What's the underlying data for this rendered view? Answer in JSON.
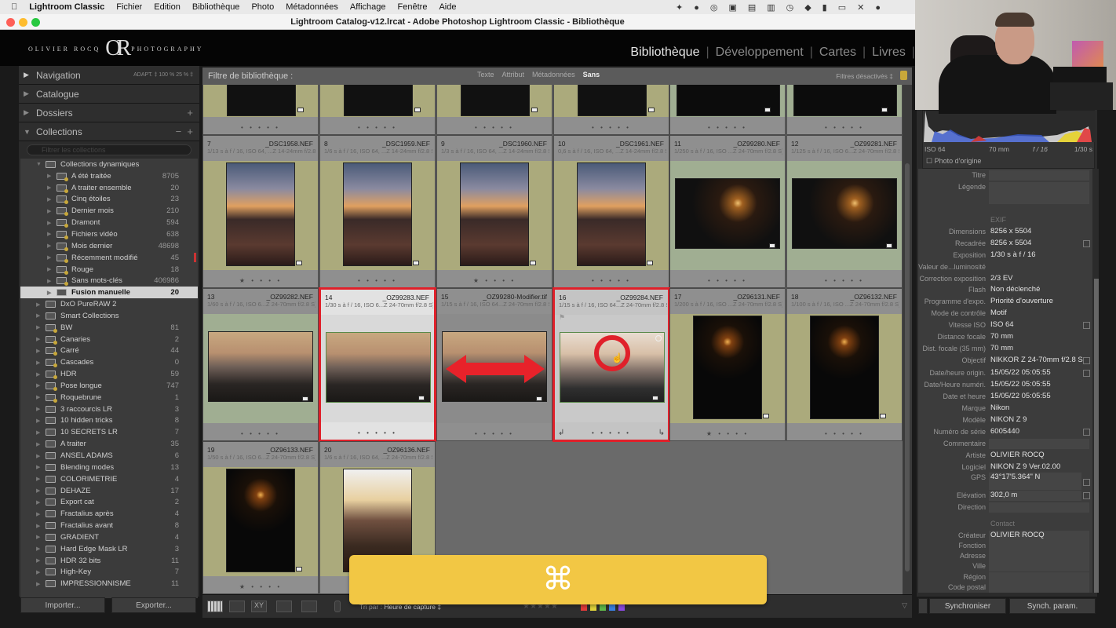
{
  "menubar": {
    "app": "Lightroom Classic",
    "items": [
      "Fichier",
      "Edition",
      "Bibliothèque",
      "Photo",
      "Métadonnées",
      "Affichage",
      "Fenêtre",
      "Aide"
    ]
  },
  "window": {
    "title": "Lightroom Catalog-v12.lrcat - Adobe Photoshop Lightroom Classic - Bibliothèque"
  },
  "identity_plate": {
    "left": "OLIVIER ROCQ",
    "mark": "OR",
    "right": "PHOTOGRAPHY"
  },
  "modules": [
    {
      "label": "Bibliothèque",
      "active": true
    },
    {
      "label": "Développement"
    },
    {
      "label": "Cartes"
    },
    {
      "label": "Livres"
    }
  ],
  "left_panel": {
    "navigation": {
      "label": "Navigation",
      "zoom_options": "ADAPT. ‡   100 %   25 % ‡"
    },
    "catalogue": "Catalogue",
    "dossiers": "Dossiers",
    "collections": "Collections",
    "collections_search_placeholder": "Filtrer les collections",
    "items": [
      {
        "name": "Collections dynamiques",
        "count": "",
        "type": "set",
        "level": 0,
        "expanded": true
      },
      {
        "name": "A été traitée",
        "count": "8705",
        "type": "smart",
        "level": 1
      },
      {
        "name": "A traiter ensemble",
        "count": "20",
        "type": "smart",
        "level": 1
      },
      {
        "name": "Cinq étoiles",
        "count": "23",
        "type": "smart",
        "level": 1
      },
      {
        "name": "Dernier mois",
        "count": "210",
        "type": "smart",
        "level": 1
      },
      {
        "name": "Dramont",
        "count": "594",
        "type": "smart",
        "level": 1
      },
      {
        "name": "Fichiers vidéo",
        "count": "638",
        "type": "smart",
        "level": 1
      },
      {
        "name": "Mois dernier",
        "count": "48698",
        "type": "smart",
        "level": 1
      },
      {
        "name": "Récemment modifié",
        "count": "45",
        "type": "smart",
        "level": 1
      },
      {
        "name": "Rouge",
        "count": "18",
        "type": "smart",
        "level": 1
      },
      {
        "name": "Sans mots-clés",
        "count": "406986",
        "type": "smart",
        "level": 1
      },
      {
        "name": "Fusion manuelle",
        "count": "20",
        "type": "normal",
        "level": 1,
        "selected": true
      },
      {
        "name": "DxO PureRAW 2",
        "count": "",
        "type": "set",
        "level": 0
      },
      {
        "name": "Smart Collections",
        "count": "",
        "type": "set",
        "level": 0
      },
      {
        "name": "BW",
        "count": "81",
        "type": "smart",
        "level": 0
      },
      {
        "name": "Canaries",
        "count": "2",
        "type": "smart",
        "level": 0
      },
      {
        "name": "Carré",
        "count": "44",
        "type": "smart",
        "level": 0
      },
      {
        "name": "Cascades",
        "count": "0",
        "type": "smart",
        "level": 0
      },
      {
        "name": "HDR",
        "count": "59",
        "type": "smart",
        "level": 0
      },
      {
        "name": "Pose longue",
        "count": "747",
        "type": "smart",
        "level": 0
      },
      {
        "name": "Roquebrune",
        "count": "1",
        "type": "smart",
        "level": 0
      },
      {
        "name": "3 raccourcis LR",
        "count": "3",
        "type": "normal",
        "level": 0
      },
      {
        "name": "10 hidden tricks",
        "count": "8",
        "type": "normal",
        "level": 0
      },
      {
        "name": "10 SECRETS LR",
        "count": "7",
        "type": "normal",
        "level": 0
      },
      {
        "name": "A traiter",
        "count": "35",
        "type": "normal",
        "level": 0
      },
      {
        "name": "ANSEL ADAMS",
        "count": "6",
        "type": "normal",
        "level": 0
      },
      {
        "name": "Blending modes",
        "count": "13",
        "type": "normal",
        "level": 0
      },
      {
        "name": "COLORIMETRIE",
        "count": "4",
        "type": "normal",
        "level": 0
      },
      {
        "name": "DEHAZE",
        "count": "17",
        "type": "normal",
        "level": 0
      },
      {
        "name": "Export cat",
        "count": "2",
        "type": "normal",
        "level": 0
      },
      {
        "name": "Fractalius après",
        "count": "4",
        "type": "normal",
        "level": 0
      },
      {
        "name": "Fractalius avant",
        "count": "8",
        "type": "normal",
        "level": 0
      },
      {
        "name": "GRADIENT",
        "count": "4",
        "type": "normal",
        "level": 0
      },
      {
        "name": "Hard Edge Mask LR",
        "count": "3",
        "type": "normal",
        "level": 0
      },
      {
        "name": "HDR 32 bits",
        "count": "11",
        "type": "normal",
        "level": 0
      },
      {
        "name": "High-Key",
        "count": "7",
        "type": "normal",
        "level": 0
      },
      {
        "name": "IMPRESSIONNISME",
        "count": "11",
        "type": "normal",
        "level": 0
      }
    ],
    "import_label": "Importer...",
    "export_label": "Exporter..."
  },
  "filter_bar": {
    "label": "Filtre de bibliothèque :",
    "options": [
      "Texte",
      "Attribut",
      "Métadonnées",
      "Sans"
    ],
    "active": "Sans",
    "status": "Filtres désactivés ‡"
  },
  "grid": {
    "top_row_stars": [
      0,
      0,
      0,
      0,
      0,
      0
    ],
    "cells": [
      {
        "num": "7",
        "file": "_DSC1958.NEF",
        "exif": "1/13 s à f / 16, ISO 64, ...Z 14-24mm f/2.8 S)",
        "stars": 1,
        "label": "yellow",
        "orient": "portrait",
        "scene": "beach"
      },
      {
        "num": "8",
        "file": "_DSC1959.NEF",
        "exif": "1/6 s à f / 16, ISO 64, ...Z 14-24mm f/2.8 S)",
        "stars": 0,
        "label": "yellow",
        "orient": "portrait",
        "scene": "beach"
      },
      {
        "num": "9",
        "file": "_DSC1960.NEF",
        "exif": "1/3 s à f / 16, ISO 64, ...Z 14-24mm f/2.8 S)",
        "stars": 1,
        "label": "yellow",
        "orient": "portrait",
        "scene": "beach"
      },
      {
        "num": "10",
        "file": "_DSC1961.NEF",
        "exif": "0,6 s à f / 16, ISO 64, ...Z 14-24mm f/2.8 S)",
        "stars": 0,
        "label": "yellow",
        "orient": "portrait",
        "scene": "beach"
      },
      {
        "num": "11",
        "file": "_OZ99280.NEF",
        "exif": "1/250 s à f / 16, ISO ...Z 24-70mm f/2.8 S)",
        "stars": 0,
        "label": "green",
        "orient": "landscape",
        "scene": "dark"
      },
      {
        "num": "12",
        "file": "_OZ99281.NEF",
        "exif": "1/125 s à f / 16, ISO 6...Z 24-70mm f/2.8 S)",
        "stars": 0,
        "label": "green",
        "orient": "landscape",
        "scene": "dark"
      },
      {
        "num": "13",
        "file": "_OZ99282.NEF",
        "exif": "1/60 s à f / 16, ISO 6...Z 24-70mm f/2.8 S)",
        "stars": 0,
        "label": "green",
        "orient": "landscape",
        "scene": "mist"
      },
      {
        "num": "14",
        "file": "_OZ99283.NEF",
        "exif": "1/30 s à f / 16, ISO 6...Z 24-70mm f/2.8 S)",
        "stars": 0,
        "label": "selected",
        "orient": "landscape",
        "scene": "mist",
        "highlight": true
      },
      {
        "num": "15",
        "file": "_OZ99280-Modifier.tif",
        "exif": "1/15 s à f / 16, ISO 64...Z 24-70mm f/2.8 S)",
        "stars": 0,
        "label": "none",
        "orient": "landscape",
        "scene": "mist",
        "arrow": true
      },
      {
        "num": "16",
        "file": "_OZ99284.NEF",
        "exif": "1/15 s à f / 16, ISO 64...Z 24-70mm f/2.8 S)",
        "stars": 0,
        "label": "active",
        "orient": "landscape",
        "scene": "bright",
        "highlight": true,
        "cursor": true
      },
      {
        "num": "17",
        "file": "_OZ96131.NEF",
        "exif": "1/200 s à f / 16, ISO ...Z 24-70mm f/2.8 S)",
        "stars": 1,
        "label": "yellow",
        "orient": "portrait",
        "scene": "night"
      },
      {
        "num": "18",
        "file": "_OZ96132.NEF",
        "exif": "1/100 s à f / 16, ISO ...Z 24-70mm f/2.8 S)",
        "stars": 0,
        "label": "yellow",
        "orient": "portrait",
        "scene": "night"
      },
      {
        "num": "19",
        "file": "_OZ96133.NEF",
        "exif": "1/50 s à f / 16, ISO 6...Z 24-70mm f/2.8 S)",
        "stars": 1,
        "label": "yellow",
        "orient": "portrait",
        "scene": "night"
      },
      {
        "num": "20",
        "file": "_OZ96136.NEF",
        "exif": "1/6 s à f / 16, ISO 64, ...Z 24-70mm f/2.8 S)",
        "stars": 0,
        "label": "yellow",
        "orient": "portrait",
        "scene": "field"
      }
    ]
  },
  "toolbar": {
    "sort_label": "Tri par :",
    "sort_value": "Heure de capture ‡",
    "rating_stars": "★★★★★",
    "color_labels": [
      "#e03a3a",
      "#e0d33a",
      "#5fb84a",
      "#3a7fe0",
      "#8a4ae0"
    ]
  },
  "histogram": {
    "iso": "ISO 64",
    "focal": "70 mm",
    "aperture": "f / 16",
    "shutter": "1/30 s",
    "original_label": "Photo d'origine"
  },
  "metadata": [
    {
      "k": "Titre",
      "v": "",
      "field": true
    },
    {
      "k": "Légende",
      "v": "",
      "field": true
    },
    {
      "section": "EXIF"
    },
    {
      "k": "Dimensions",
      "v": "8256 x 5504"
    },
    {
      "k": "Recadrée",
      "v": "8256 x 5504",
      "btn": true
    },
    {
      "k": "Exposition",
      "v": "1/30 s à f / 16"
    },
    {
      "k": "Valeur de...luminosité",
      "v": ""
    },
    {
      "k": "Correction exposition",
      "v": "2/3 EV"
    },
    {
      "k": "Flash",
      "v": "Non déclenché"
    },
    {
      "k": "Programme d'expo.",
      "v": "Priorité d'ouverture"
    },
    {
      "k": "Mode de contrôle",
      "v": "Motif"
    },
    {
      "k": "Vitesse ISO",
      "v": "ISO 64",
      "btn": true
    },
    {
      "k": "Distance focale",
      "v": "70 mm"
    },
    {
      "k": "Dist. focale (35 mm)",
      "v": "70 mm"
    },
    {
      "k": "Objectif",
      "v": "NIKKOR Z 24-70mm f/2.8 S",
      "btn": true
    },
    {
      "k": "Date/heure origin.",
      "v": "15/05/22 05:05:55",
      "btn": true
    },
    {
      "k": "Date/Heure numéri.",
      "v": "15/05/22 05:05:55"
    },
    {
      "k": "Date et heure",
      "v": "15/05/22 05:05:55"
    },
    {
      "k": "Marque",
      "v": "Nikon"
    },
    {
      "k": "Modèle",
      "v": "NIKON Z 9"
    },
    {
      "k": "Numéro de série",
      "v": "6005440",
      "btn": true
    },
    {
      "k": "Commentaire",
      "v": "",
      "field": true
    },
    {
      "k": "Artiste",
      "v": "OLIVIER ROCQ"
    },
    {
      "k": "Logiciel",
      "v": "NIKON Z 9 Ver.02.00"
    },
    {
      "k": "GPS",
      "v": "43°17'5.364\" N",
      "field": true,
      "btn": true
    },
    {
      "k": "Elévation",
      "v": "302,0 m",
      "field": true,
      "btn": true
    },
    {
      "k": "Direction",
      "v": "",
      "field": true
    },
    {
      "section": "Contact"
    },
    {
      "k": "Créateur",
      "v": "OLIVIER ROCQ",
      "field": true
    },
    {
      "k": "Fonction",
      "v": "",
      "field": true
    },
    {
      "k": "Adresse",
      "v": "",
      "field": true
    },
    {
      "k": "Ville",
      "v": "",
      "field": true
    },
    {
      "k": "Région",
      "v": "",
      "field": true
    },
    {
      "k": "Code postal",
      "v": "",
      "field": true
    }
  ],
  "right_buttons": {
    "sync": "Synchroniser",
    "sync_settings": "Synch. param."
  },
  "overlay": {
    "key": "⌘"
  },
  "colors": {
    "selection_red": "#e0202a",
    "overlay_yellow": "#f2c744",
    "label_yellow": "#abaa7c",
    "label_green": "#a0ae92"
  }
}
